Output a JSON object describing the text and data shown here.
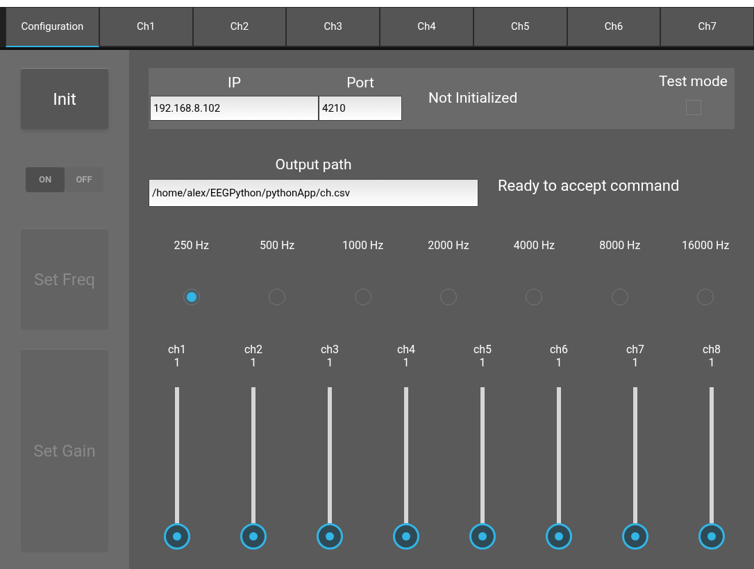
{
  "tabs": [
    {
      "label": "Configuration",
      "selected": true
    },
    {
      "label": "Ch1",
      "selected": false
    },
    {
      "label": "Ch2",
      "selected": false
    },
    {
      "label": "Ch3",
      "selected": false
    },
    {
      "label": "Ch4",
      "selected": false
    },
    {
      "label": "Ch5",
      "selected": false
    },
    {
      "label": "Ch6",
      "selected": false
    },
    {
      "label": "Ch7",
      "selected": false
    }
  ],
  "sidebar": {
    "init_button": {
      "label": "Init",
      "disabled": false
    },
    "toggle": {
      "on_label": "ON",
      "off_label": "OFF",
      "on": true,
      "disabled": true
    },
    "freq_button": {
      "label": "Set Freq",
      "disabled": true
    },
    "gain_button": {
      "label": "Set Gain",
      "disabled": true
    }
  },
  "connection": {
    "ip_label": "IP",
    "ip_value": "192.168.8.102",
    "port_label": "Port",
    "port_value": "4210",
    "status": "Not Initialized",
    "test_mode_label": "Test mode",
    "test_mode_checked": false
  },
  "output": {
    "label": "Output path",
    "value": "/home/alex/EEGPython/pythonApp/ch.csv",
    "status": "Ready to accept command"
  },
  "frequencies": [
    {
      "label": "250 Hz",
      "selected": true
    },
    {
      "label": "500 Hz",
      "selected": false
    },
    {
      "label": "1000 Hz",
      "selected": false
    },
    {
      "label": "2000 Hz",
      "selected": false
    },
    {
      "label": "4000 Hz",
      "selected": false
    },
    {
      "label": "8000 Hz",
      "selected": false
    },
    {
      "label": "16000 Hz",
      "selected": false
    }
  ],
  "channels": [
    {
      "name": "ch1",
      "value": "1"
    },
    {
      "name": "ch2",
      "value": "1"
    },
    {
      "name": "ch3",
      "value": "1"
    },
    {
      "name": "ch4",
      "value": "1"
    },
    {
      "name": "ch5",
      "value": "1"
    },
    {
      "name": "ch6",
      "value": "1"
    },
    {
      "name": "ch7",
      "value": "1"
    },
    {
      "name": "ch8",
      "value": "1"
    }
  ]
}
